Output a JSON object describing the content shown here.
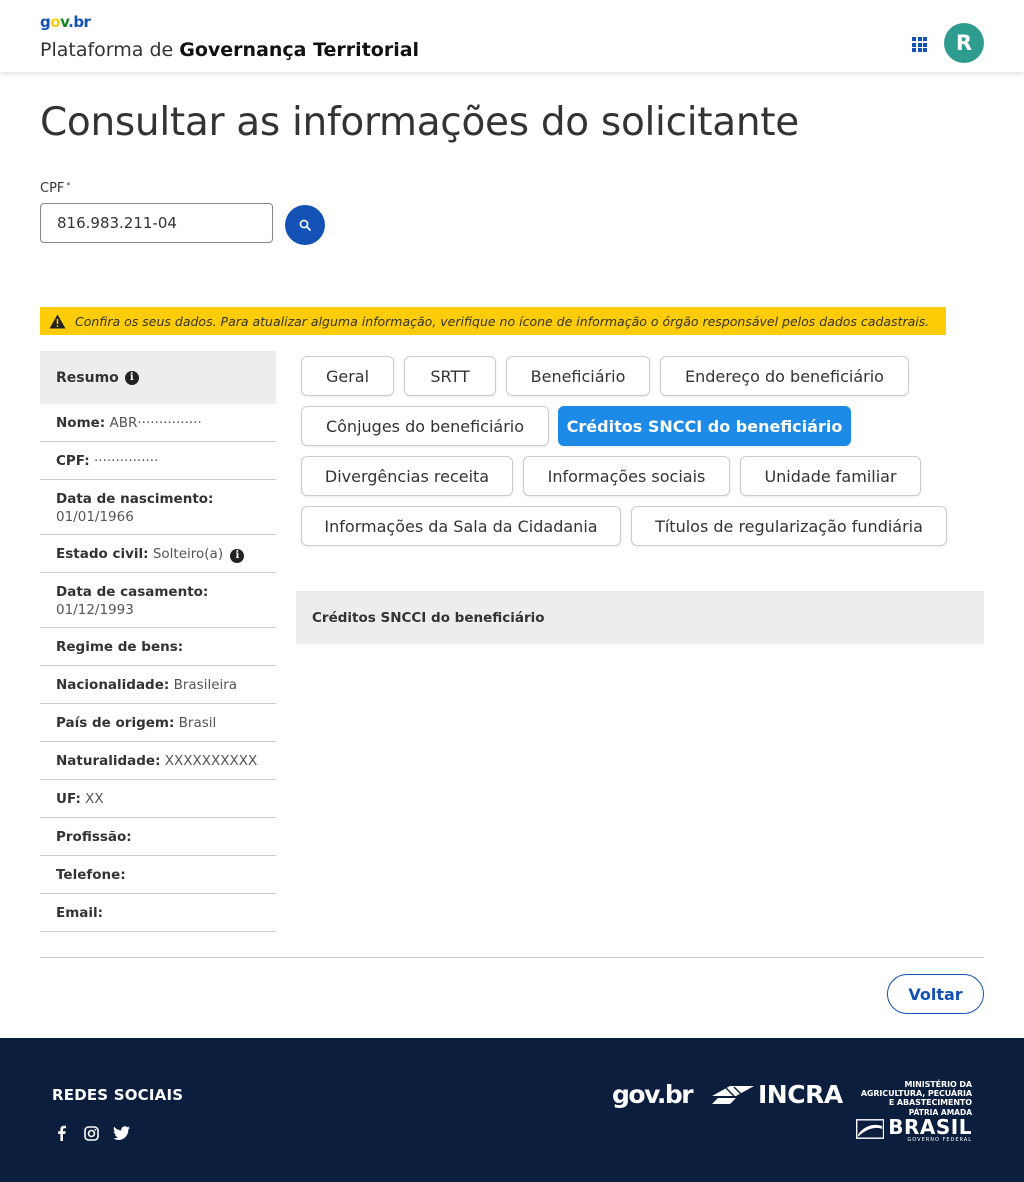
{
  "header": {
    "logo": {
      "g": "g",
      "o": "o",
      "v": "v",
      "b": ".br"
    },
    "title_prefix": "Plataforma de ",
    "title_bold": "Governança Territorial",
    "avatar_initial": "R",
    "apps_icon": "grid-apps-icon"
  },
  "page": {
    "title": "Consultar as informações do solicitante"
  },
  "cpf": {
    "label": "CPF",
    "required_mark": "*",
    "value": "816.983.211-04"
  },
  "warning": {
    "text": "Confira os seus dados. Para atualizar alguma informação, verifique no ícone de informação o órgão responsável pelos dados cadastrais."
  },
  "sidebar": {
    "header": "Resumo",
    "rows": [
      {
        "label": "Nome:",
        "value": "ABR···············"
      },
      {
        "label": "CPF:",
        "value": "···············"
      },
      {
        "label": "Data de nascimento:",
        "value": "01/01/1966"
      },
      {
        "label": "Estado civil:",
        "value": "Solteiro(a)"
      },
      {
        "label": "Data de casamento:",
        "value": "01/12/1993"
      },
      {
        "label": "Regime de bens:",
        "value": ""
      },
      {
        "label": "Nacionalidade:",
        "value": "Brasileira"
      },
      {
        "label": "País de origem:",
        "value": "Brasil"
      },
      {
        "label": "Naturalidade:",
        "value": "XXXXXXXXXX"
      },
      {
        "label": "UF:",
        "value": "XX"
      },
      {
        "label": "Profissão:",
        "value": ""
      },
      {
        "label": "Telefone:",
        "value": ""
      },
      {
        "label": "Email:",
        "value": ""
      }
    ]
  },
  "tabs": [
    {
      "label": "Geral"
    },
    {
      "label": "SRTT"
    },
    {
      "label": "Beneficiário"
    },
    {
      "label": "Endereço do beneficiário"
    },
    {
      "label": "Cônjuges do beneficiário"
    },
    {
      "label": "Créditos SNCCI do beneficiário",
      "active": true
    },
    {
      "label": "Divergências receita"
    },
    {
      "label": "Informações sociais"
    },
    {
      "label": "Unidade familiar"
    },
    {
      "label": "Informações da Sala da Cidadania"
    },
    {
      "label": "Títulos de regularização fundiária"
    }
  ],
  "content": {
    "panel_title": "Créditos SNCCI do beneficiário"
  },
  "actions": {
    "back_label": "Voltar"
  },
  "footer": {
    "social_title": "REDES SOCIAIS",
    "social_icons": [
      "facebook-icon",
      "instagram-icon",
      "twitter-icon"
    ],
    "govbr_logo": "gov.br",
    "incra_logo": "INCRA",
    "ministry_lines": [
      "MINISTÉRIO DA",
      "AGRICULTURA, PECUÁRIA",
      "E ABASTECIMENTO"
    ],
    "patria": "PÁTRIA AMADA",
    "brasil": "BRASIL",
    "gov_fed": "GOVERNO FEDERAL"
  },
  "colors": {
    "primary": "#1351b4",
    "active_tab": "#1c8ae6",
    "warning": "#ffcd07",
    "avatar": "#2e9d8f",
    "footer": "#0c1e3e"
  }
}
